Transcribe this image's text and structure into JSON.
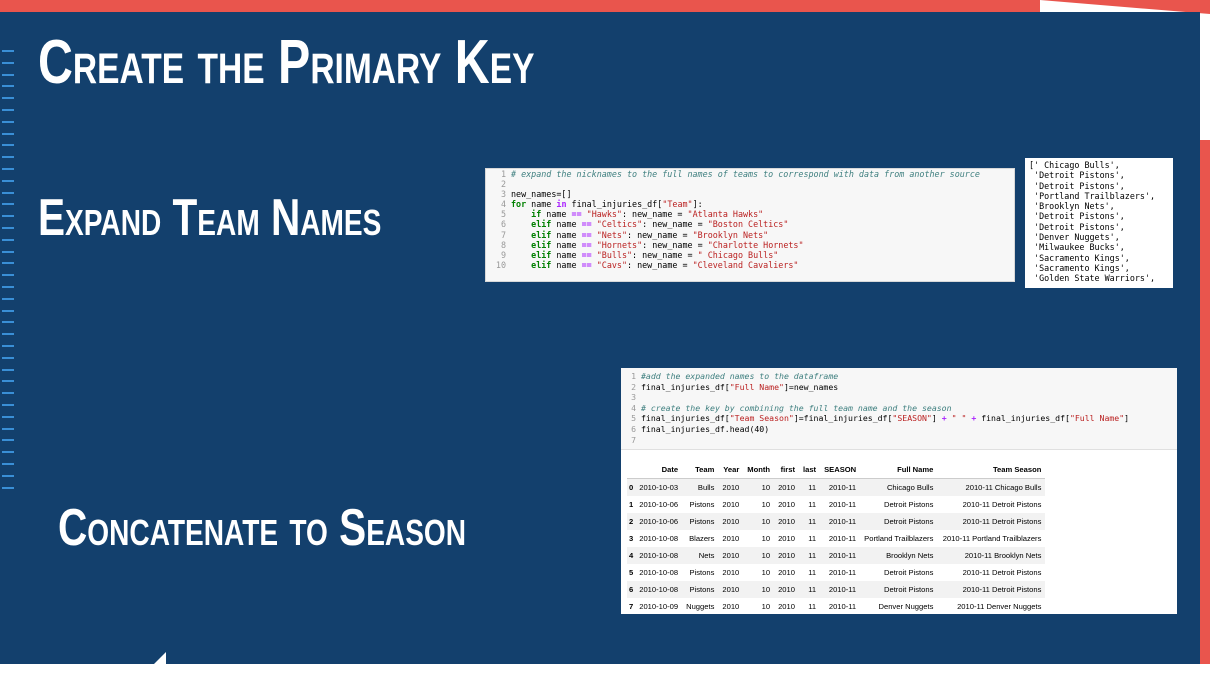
{
  "slide": {
    "title": "Create the Primary Key",
    "subheading_1": "Expand Team Names",
    "subheading_2": "Concatenate to Season"
  },
  "code_cell_1": {
    "lines": [
      {
        "n": "1",
        "parts": [
          {
            "t": "# expand the nicknames to the full names of teams to correspond with data from another source",
            "c": "cm"
          }
        ]
      },
      {
        "n": "2",
        "parts": [
          {
            "t": "",
            "c": ""
          }
        ]
      },
      {
        "n": "3",
        "parts": [
          {
            "t": "new_names=[]",
            "c": ""
          }
        ]
      },
      {
        "n": "4",
        "parts": [
          {
            "t": "for",
            "c": "kw"
          },
          {
            "t": " name ",
            "c": ""
          },
          {
            "t": "in",
            "c": "op"
          },
          {
            "t": " final_injuries_df[",
            "c": ""
          },
          {
            "t": "\"Team\"",
            "c": "st"
          },
          {
            "t": "]:",
            "c": ""
          }
        ]
      },
      {
        "n": "5",
        "parts": [
          {
            "t": "    ",
            "c": ""
          },
          {
            "t": "if",
            "c": "kw"
          },
          {
            "t": " name ",
            "c": ""
          },
          {
            "t": "==",
            "c": "op"
          },
          {
            "t": " ",
            "c": ""
          },
          {
            "t": "\"Hawks\"",
            "c": "st"
          },
          {
            "t": ": new_name = ",
            "c": ""
          },
          {
            "t": "\"Atlanta Hawks\"",
            "c": "st"
          }
        ]
      },
      {
        "n": "6",
        "parts": [
          {
            "t": "    ",
            "c": ""
          },
          {
            "t": "elif",
            "c": "kw"
          },
          {
            "t": " name ",
            "c": ""
          },
          {
            "t": "==",
            "c": "op"
          },
          {
            "t": " ",
            "c": ""
          },
          {
            "t": "\"Celtics\"",
            "c": "st"
          },
          {
            "t": ": new_name = ",
            "c": ""
          },
          {
            "t": "\"Boston Celtics\"",
            "c": "st"
          }
        ]
      },
      {
        "n": "7",
        "parts": [
          {
            "t": "    ",
            "c": ""
          },
          {
            "t": "elif",
            "c": "kw"
          },
          {
            "t": " name ",
            "c": ""
          },
          {
            "t": "==",
            "c": "op"
          },
          {
            "t": " ",
            "c": ""
          },
          {
            "t": "\"Nets\"",
            "c": "st"
          },
          {
            "t": ": new_name = ",
            "c": ""
          },
          {
            "t": "\"Brooklyn Nets\"",
            "c": "st"
          }
        ]
      },
      {
        "n": "8",
        "parts": [
          {
            "t": "    ",
            "c": ""
          },
          {
            "t": "elif",
            "c": "kw"
          },
          {
            "t": " name ",
            "c": ""
          },
          {
            "t": "==",
            "c": "op"
          },
          {
            "t": " ",
            "c": ""
          },
          {
            "t": "\"Hornets\"",
            "c": "st"
          },
          {
            "t": ": new_name = ",
            "c": ""
          },
          {
            "t": "\"Charlotte Hornets\"",
            "c": "st"
          }
        ]
      },
      {
        "n": "9",
        "parts": [
          {
            "t": "    ",
            "c": ""
          },
          {
            "t": "elif",
            "c": "kw"
          },
          {
            "t": " name ",
            "c": ""
          },
          {
            "t": "==",
            "c": "op"
          },
          {
            "t": " ",
            "c": ""
          },
          {
            "t": "\"Bulls\"",
            "c": "st"
          },
          {
            "t": ": new_name = ",
            "c": ""
          },
          {
            "t": "\" Chicago Bulls\"",
            "c": "st"
          }
        ]
      },
      {
        "n": "10",
        "parts": [
          {
            "t": "    ",
            "c": ""
          },
          {
            "t": "elif",
            "c": "kw"
          },
          {
            "t": " name ",
            "c": ""
          },
          {
            "t": "==",
            "c": "op"
          },
          {
            "t": " ",
            "c": ""
          },
          {
            "t": "\"Cavs\"",
            "c": "st"
          },
          {
            "t": ": new_name = ",
            "c": ""
          },
          {
            "t": "\"Cleveland Cavaliers\"",
            "c": "st"
          }
        ]
      }
    ]
  },
  "output_list": [
    "[' Chicago Bulls',",
    " 'Detroit Pistons',",
    " 'Detroit Pistons',",
    " 'Portland Trailblazers',",
    " 'Brooklyn Nets',",
    " 'Detroit Pistons',",
    " 'Detroit Pistons',",
    " 'Denver Nuggets',",
    " 'Milwaukee Bucks',",
    " 'Sacramento Kings',",
    " 'Sacramento Kings',",
    " 'Golden State Warriors',"
  ],
  "code_cell_2": {
    "lines": [
      {
        "n": "1",
        "parts": [
          {
            "t": "#add the expanded names to the dataframe",
            "c": "cm"
          }
        ]
      },
      {
        "n": "2",
        "parts": [
          {
            "t": "final_injuries_df[",
            "c": ""
          },
          {
            "t": "\"Full Name\"",
            "c": "st"
          },
          {
            "t": "]=new_names",
            "c": ""
          }
        ]
      },
      {
        "n": "3",
        "parts": [
          {
            "t": "",
            "c": ""
          }
        ]
      },
      {
        "n": "4",
        "parts": [
          {
            "t": "# create the key by combining the full team name and the season",
            "c": "cm"
          }
        ]
      },
      {
        "n": "5",
        "parts": [
          {
            "t": "final_injuries_df[",
            "c": ""
          },
          {
            "t": "\"Team Season\"",
            "c": "st"
          },
          {
            "t": "]=final_injuries_df[",
            "c": ""
          },
          {
            "t": "\"SEASON\"",
            "c": "st"
          },
          {
            "t": "] ",
            "c": ""
          },
          {
            "t": "+",
            "c": "op"
          },
          {
            "t": " ",
            "c": ""
          },
          {
            "t": "\" \"",
            "c": "st"
          },
          {
            "t": " ",
            "c": ""
          },
          {
            "t": "+",
            "c": "op"
          },
          {
            "t": " final_injuries_df[",
            "c": ""
          },
          {
            "t": "\"Full Name\"",
            "c": "st"
          },
          {
            "t": "]",
            "c": ""
          }
        ]
      },
      {
        "n": "6",
        "parts": [
          {
            "t": "final_injuries_df.head(40)",
            "c": ""
          }
        ]
      },
      {
        "n": "7",
        "parts": [
          {
            "t": "",
            "c": ""
          }
        ]
      }
    ]
  },
  "dataframe": {
    "columns": [
      "",
      "Date",
      "Team",
      "Year",
      "Month",
      "first",
      "last",
      "SEASON",
      "Full Name",
      "Team Season"
    ],
    "rows": [
      [
        "0",
        "2010-10-03",
        "Bulls",
        "2010",
        "10",
        "2010",
        "11",
        "2010-11",
        "Chicago Bulls",
        "2010-11 Chicago Bulls"
      ],
      [
        "1",
        "2010-10-06",
        "Pistons",
        "2010",
        "10",
        "2010",
        "11",
        "2010-11",
        "Detroit Pistons",
        "2010-11 Detroit Pistons"
      ],
      [
        "2",
        "2010-10-06",
        "Pistons",
        "2010",
        "10",
        "2010",
        "11",
        "2010-11",
        "Detroit Pistons",
        "2010-11 Detroit Pistons"
      ],
      [
        "3",
        "2010-10-08",
        "Blazers",
        "2010",
        "10",
        "2010",
        "11",
        "2010-11",
        "Portland Trailblazers",
        "2010-11 Portland Trailblazers"
      ],
      [
        "4",
        "2010-10-08",
        "Nets",
        "2010",
        "10",
        "2010",
        "11",
        "2010-11",
        "Brooklyn Nets",
        "2010-11 Brooklyn Nets"
      ],
      [
        "5",
        "2010-10-08",
        "Pistons",
        "2010",
        "10",
        "2010",
        "11",
        "2010-11",
        "Detroit Pistons",
        "2010-11 Detroit Pistons"
      ],
      [
        "6",
        "2010-10-08",
        "Pistons",
        "2010",
        "10",
        "2010",
        "11",
        "2010-11",
        "Detroit Pistons",
        "2010-11 Detroit Pistons"
      ],
      [
        "7",
        "2010-10-09",
        "Nuggets",
        "2010",
        "10",
        "2010",
        "11",
        "2010-11",
        "Denver Nuggets",
        "2010-11 Denver Nuggets"
      ]
    ]
  },
  "colors": {
    "slide_background": "#13406d",
    "accent_red": "#e9554d",
    "tick_blue": "#3a8fd6"
  }
}
